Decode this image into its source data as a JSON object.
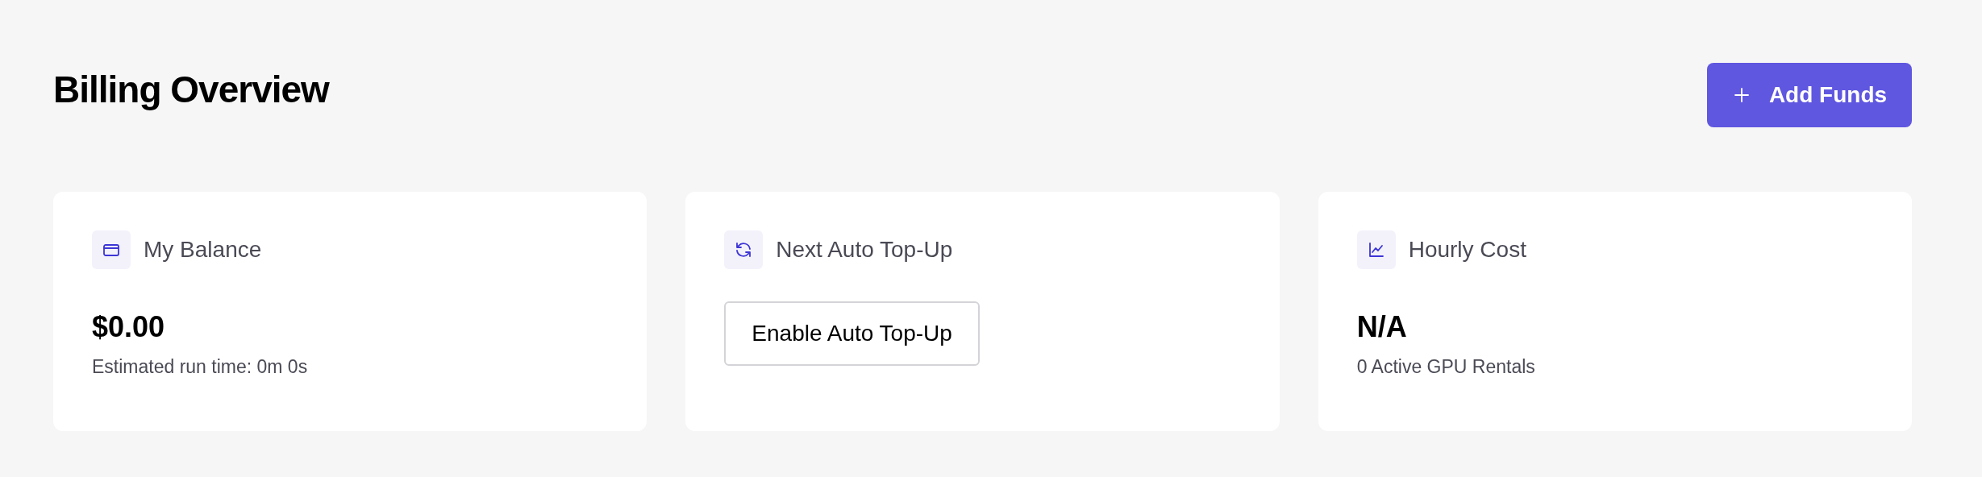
{
  "header": {
    "title": "Billing Overview",
    "button": {
      "label": "Add Funds"
    }
  },
  "cards": [
    {
      "kind": "value",
      "label": "My Balance",
      "value": "$0.00",
      "caption": "Estimated run time: 0m 0s"
    },
    {
      "kind": "action",
      "label": "Next Auto Top-Up",
      "button": "Enable Auto Top-Up"
    },
    {
      "kind": "value",
      "label": "Hourly Cost",
      "value": "N/A",
      "caption": "0 Active GPU Rentals"
    }
  ]
}
